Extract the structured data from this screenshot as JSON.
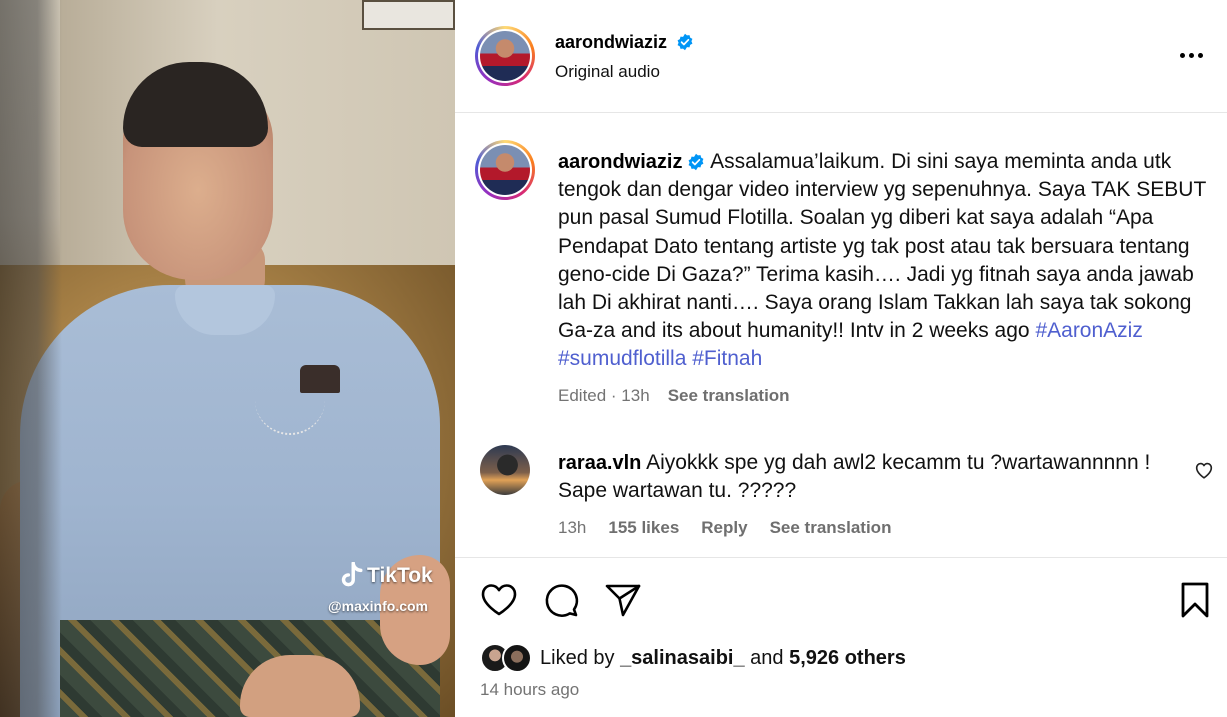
{
  "media": {
    "watermark_brand": "TikTok",
    "watermark_handle": "@maxinfo.com"
  },
  "header": {
    "username": "aarondwiaziz",
    "subtitle": "Original audio"
  },
  "caption": {
    "username": "aarondwiaziz",
    "body": "Assalamua’laikum. Di sini saya meminta anda utk tengok dan dengar video interview yg sepenuhnya. Saya TAK SEBUT pun pasal Sumud Flotilla. Soalan yg diberi kat saya adalah “Apa Pendapat Dato tentang artiste yg tak post atau tak bersuara tentang geno-cide Di Gaza?” Terima kasih…. Jadi yg fitnah saya anda jawab lah Di akhirat nanti…. Saya orang Islam Takkan lah saya tak sokong Ga-za and its about humanity!! Intv in 2 weeks ago",
    "hashtags": [
      "#AaronAziz",
      "#sumudflotilla",
      "#Fitnah"
    ],
    "edited": "Edited · 13h",
    "see_translation": "See translation"
  },
  "comment": {
    "username": "raraa.vln",
    "text": "Aiyokkk spe yg dah awl2 kecamm tu ?wartawannnnn ! Sape wartawan tu. ?????",
    "time": "13h",
    "likes": "155 likes",
    "reply": "Reply",
    "see_translation": "See translation"
  },
  "likes": {
    "prefix": "Liked by",
    "user": "_salinasaibi_",
    "and": "and",
    "others": "5,926 others"
  },
  "timestamp": "14 hours ago",
  "colors": {
    "hashtag": "#4f5fcf",
    "verified": "#0095f6",
    "muted": "#737373"
  }
}
